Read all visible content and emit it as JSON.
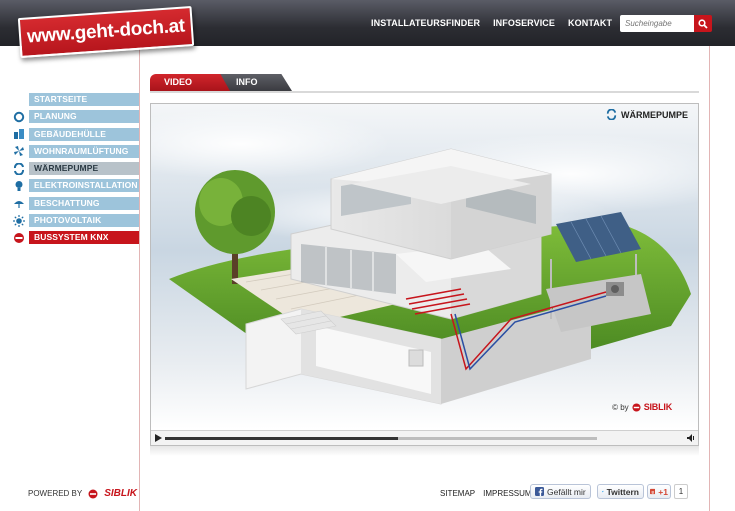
{
  "logo": {
    "text": "www.geht-doch.at"
  },
  "topnav": {
    "items": [
      "INSTALLATEURSFINDER",
      "INFOSERVICE",
      "KONTAKT"
    ]
  },
  "search": {
    "placeholder": "Sucheingabe"
  },
  "sidebar": {
    "items": [
      {
        "label": "STARTSEITE",
        "icon": "none"
      },
      {
        "label": "PLANUNG",
        "icon": "ring-icon"
      },
      {
        "label": "GEBÄUDEHÜLLE",
        "icon": "building-icon"
      },
      {
        "label": "WOHNRAUMLÜFTUNG",
        "icon": "ventilation-icon"
      },
      {
        "label": "WÄRMEPUMPE",
        "icon": "heat-pump-icon",
        "active": true
      },
      {
        "label": "ELEKTROINSTALLATION",
        "icon": "bulb-icon"
      },
      {
        "label": "BESCHATTUNG",
        "icon": "shade-icon"
      },
      {
        "label": "PHOTOVOLTAIK",
        "icon": "sun-icon"
      },
      {
        "label": "BUSSYSTEM KNX",
        "icon": "knx-icon",
        "highlight": true
      }
    ]
  },
  "tabs": {
    "video": "VIDEO",
    "info": "INFO"
  },
  "player": {
    "scene_label": "WÄRMEPUMPE",
    "copyright_prefix": "© by",
    "copyright_brand": "SIBLIK",
    "progress": 0.54
  },
  "footer": {
    "powered_by": "POWERED BY",
    "brand": "SIBLIK",
    "links": [
      "SITEMAP",
      "IMPRESSUM"
    ],
    "facebook": "Gefällt mir",
    "twitter": "Twittern",
    "gplus": "+1",
    "gplus_count": "1"
  },
  "colors": {
    "accent_red": "#c7151c",
    "nav_blue": "#9dc4db",
    "topbar": "#2c2d33"
  }
}
